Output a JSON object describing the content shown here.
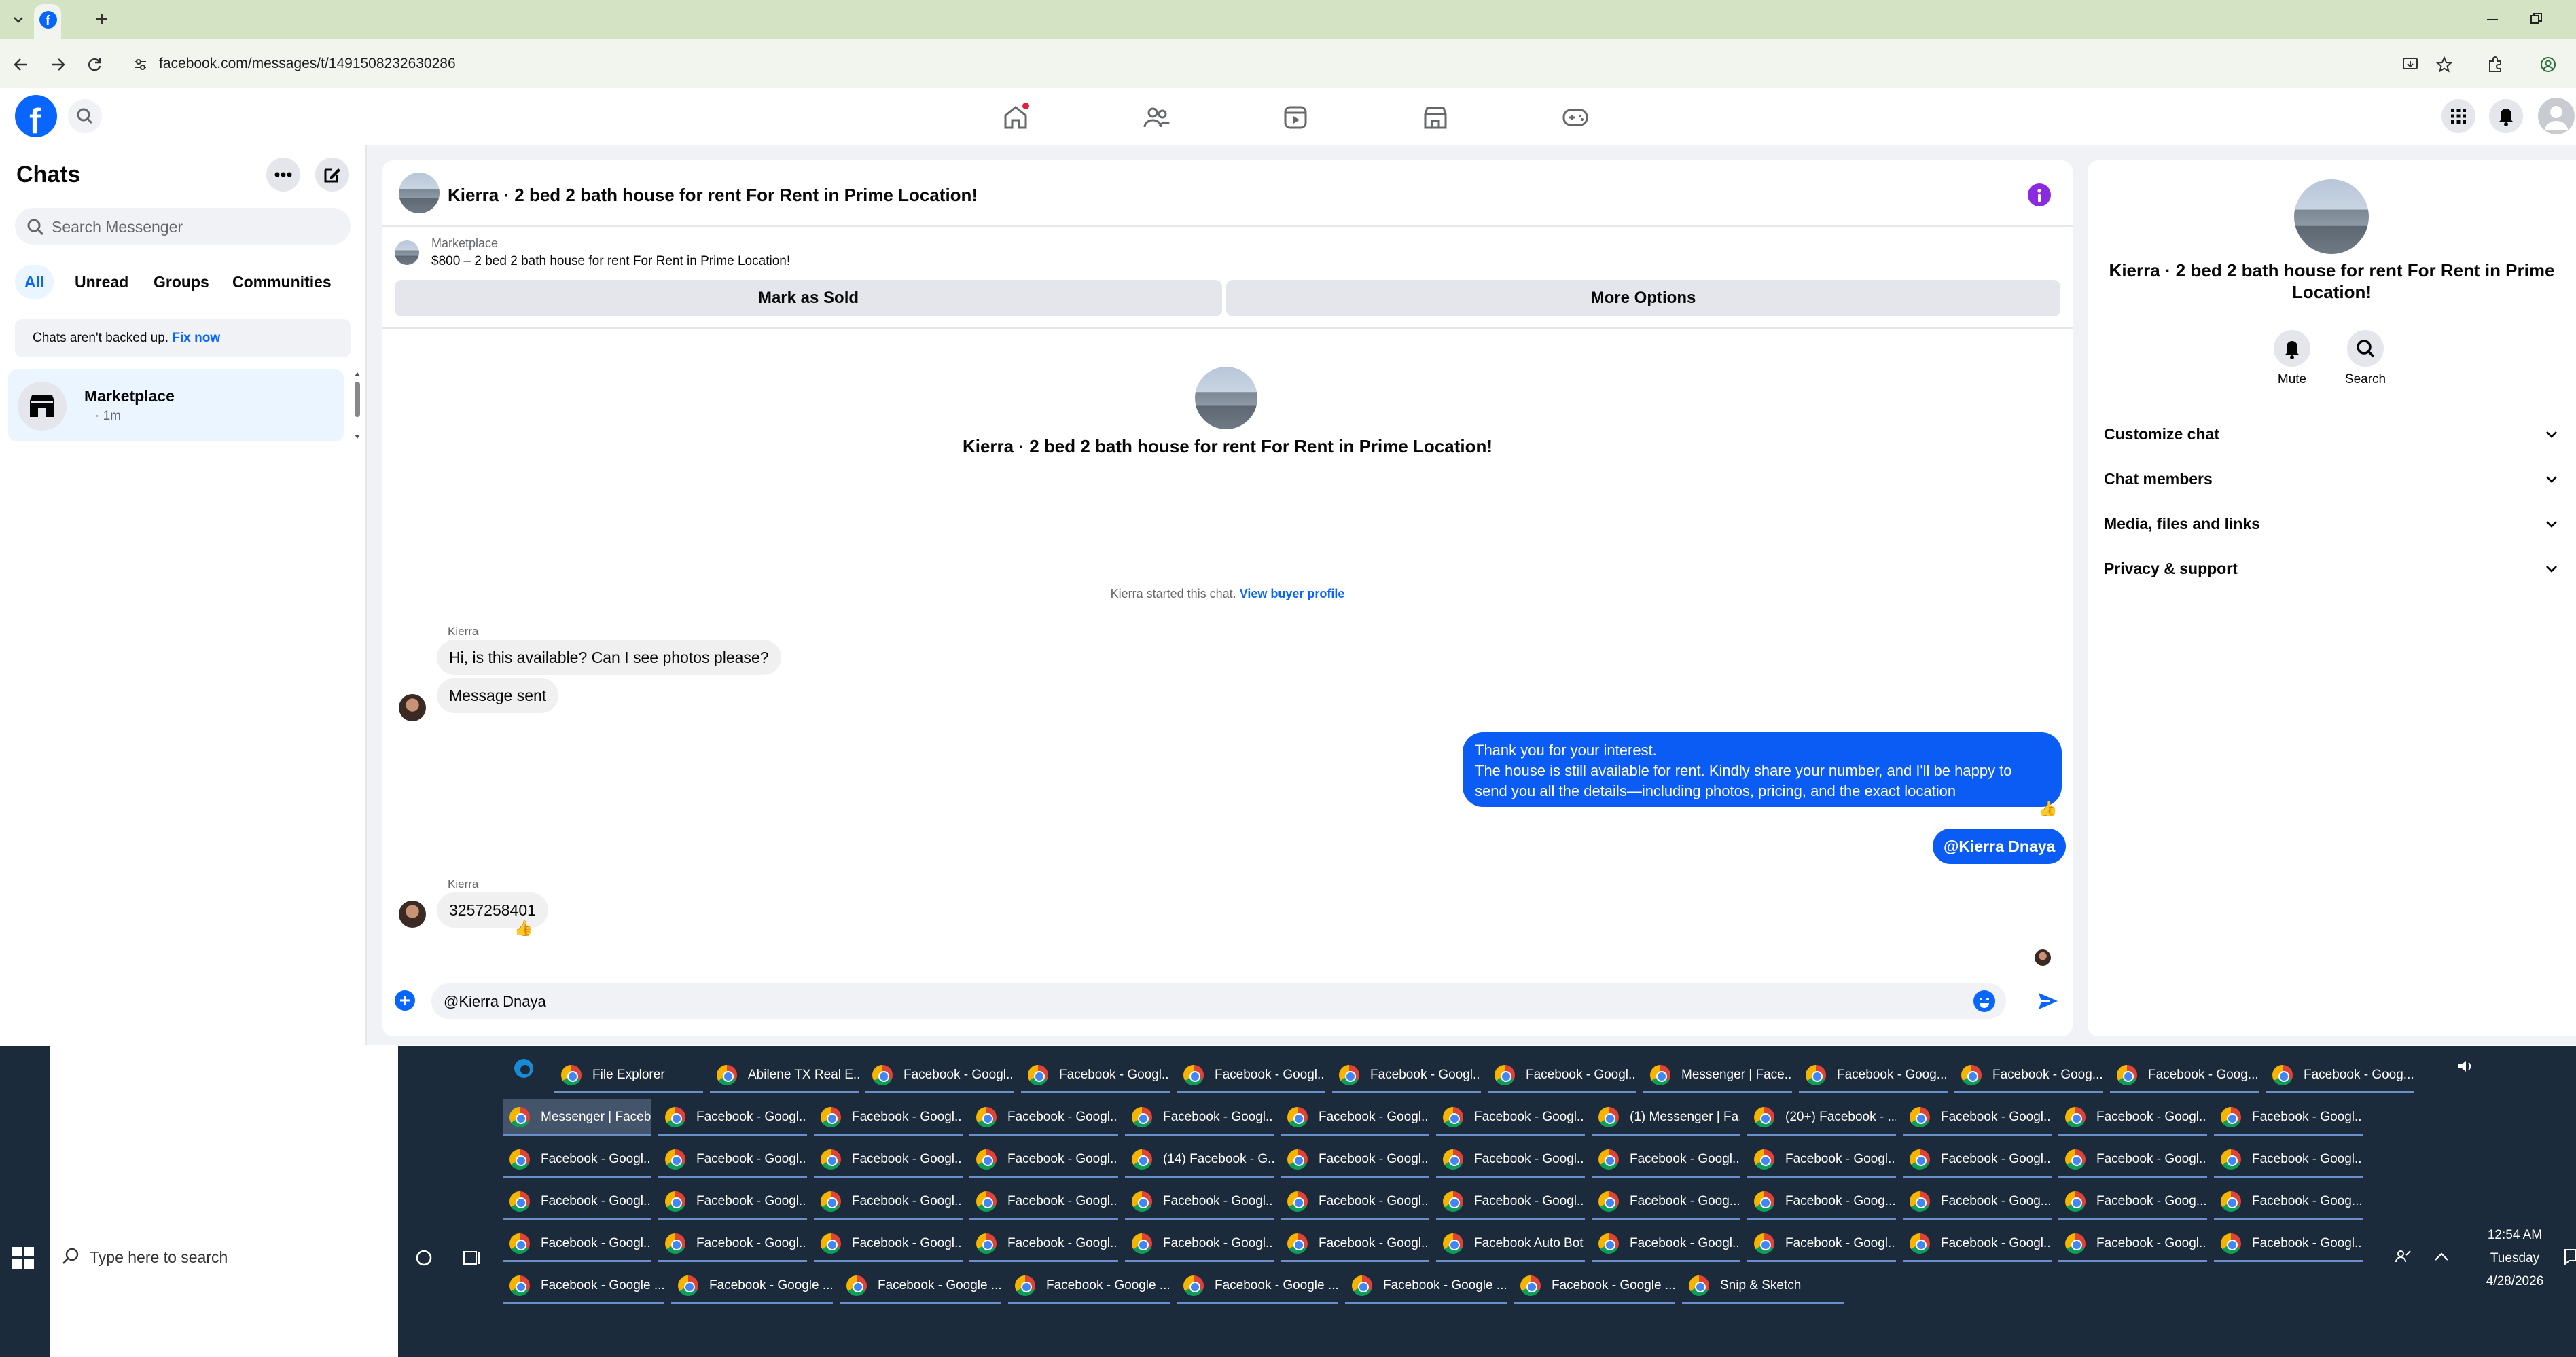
{
  "browser": {
    "url": "facebook.com/messages/t/1491508232630286"
  },
  "sidebar": {
    "title": "Chats",
    "search_placeholder": "Search Messenger",
    "filters": [
      "All",
      "Unread",
      "Groups",
      "Communities"
    ],
    "backup_notice": "Chats aren't backed up.",
    "backup_link": "Fix now",
    "chat": {
      "name": "Marketplace",
      "time": "· 1m"
    }
  },
  "conversation": {
    "title": "Kierra · 2 bed 2 bath house for rent For Rent in Prime Location!",
    "listing_source": "Marketplace",
    "listing_line": "$800 – 2 bed 2 bath house for rent For Rent in Prime Location!",
    "mark_sold": "Mark as Sold",
    "more_options": "More Options",
    "intro_title": "Kierra · 2 bed 2 bath house for rent For Rent in Prime Location!",
    "started_text": "Kierra started this chat.",
    "buyer_profile_link": "View buyer profile",
    "sender_name_1": "Kierra",
    "msg_1": "Hi, is this available? Can I see photos please?",
    "msg_2": "Message sent",
    "reply_line1": "Thank you for your interest.",
    "reply_line2": "The house is still available for rent. Kindly share your number, and I'll be happy to",
    "reply_line3": "send you all the details—including photos, pricing, and the exact location",
    "reply_mention": "@Kierra Dnaya",
    "sender_name_2": "Kierra",
    "msg_3": "3257258401",
    "composer_value": "@Kierra Dnaya"
  },
  "details": {
    "title_line1": "Kierra · 2 bed 2 bath house for rent For Rent in Prime",
    "title_line2": "Location!",
    "mute": "Mute",
    "search": "Search",
    "sections": [
      "Customize chat",
      "Chat members",
      "Media, files and links",
      "Privacy & support"
    ]
  },
  "taskbar": {
    "search_placeholder": "Type here to search",
    "time": "12:54 AM",
    "day": "Tuesday",
    "date": "4/28/2026",
    "row1": [
      "File Explorer",
      "Abilene TX Real E...",
      "Facebook - Googl...",
      "Facebook - Googl...",
      "Facebook - Googl...",
      "Facebook - Googl...",
      "Facebook - Googl...",
      "Messenger | Face...",
      "Facebook - Goog...",
      "Facebook - Goog...",
      "Facebook - Goog...",
      "Facebook - Goog..."
    ],
    "row2": [
      "Messenger | Faceb...",
      "Facebook - Googl...",
      "Facebook - Googl...",
      "Facebook - Googl...",
      "Facebook - Googl...",
      "Facebook - Googl...",
      "Facebook - Googl...",
      "(1) Messenger | Fa...",
      "(20+) Facebook - ...",
      "Facebook - Googl...",
      "Facebook - Googl...",
      "Facebook - Googl..."
    ],
    "row3": [
      "Facebook - Googl...",
      "Facebook - Googl...",
      "Facebook - Googl...",
      "Facebook - Googl...",
      "(14) Facebook - G...",
      "Facebook - Googl...",
      "Facebook - Googl...",
      "Facebook - Googl...",
      "Facebook - Googl...",
      "Facebook - Googl...",
      "Facebook - Googl...",
      "Facebook - Googl..."
    ],
    "row4": [
      "Facebook - Googl...",
      "Facebook - Googl...",
      "Facebook - Googl...",
      "Facebook - Googl...",
      "Facebook - Googl...",
      "Facebook - Googl...",
      "Facebook - Googl...",
      "Facebook - Goog...",
      "Facebook - Goog...",
      "Facebook - Goog...",
      "Facebook - Goog...",
      "Facebook - Goog..."
    ],
    "row5": [
      "Facebook - Googl...",
      "Facebook - Googl...",
      "Facebook - Googl...",
      "Facebook - Googl...",
      "Facebook - Googl...",
      "Facebook - Googl...",
      "Facebook Auto Bot",
      "Facebook - Googl...",
      "Facebook - Googl...",
      "Facebook - Googl...",
      "Facebook - Googl...",
      "Facebook - Googl..."
    ],
    "row6": [
      "Facebook - Google ...",
      "Facebook - Google ...",
      "Facebook - Google ...",
      "Facebook - Google ...",
      "Facebook - Google ...",
      "Facebook - Google ...",
      "Facebook - Google ...",
      "Snip & Sketch"
    ]
  },
  "colors": {
    "brand": "#0866ff",
    "bubble_out": "#0a5cf5",
    "page_bg": "#f0f2f5"
  }
}
